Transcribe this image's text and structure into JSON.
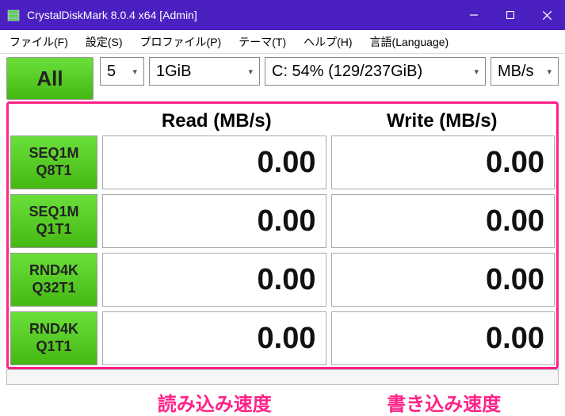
{
  "window": {
    "title": "CrystalDiskMark 8.0.4 x64 [Admin]"
  },
  "menu": {
    "file": "ファイル(F)",
    "settings": "設定(S)",
    "profile": "プロファイル(P)",
    "theme": "テーマ(T)",
    "help": "ヘルプ(H)",
    "language": "言語(Language)"
  },
  "toolbar": {
    "all_label": "All",
    "count": "5",
    "size": "1GiB",
    "drive": "C: 54% (129/237GiB)",
    "unit": "MB/s"
  },
  "headers": {
    "read": "Read (MB/s)",
    "write": "Write (MB/s)"
  },
  "tests": [
    {
      "line1": "SEQ1M",
      "line2": "Q8T1",
      "read": "0.00",
      "write": "0.00"
    },
    {
      "line1": "SEQ1M",
      "line2": "Q1T1",
      "read": "0.00",
      "write": "0.00"
    },
    {
      "line1": "RND4K",
      "line2": "Q32T1",
      "read": "0.00",
      "write": "0.00"
    },
    {
      "line1": "RND4K",
      "line2": "Q1T1",
      "read": "0.00",
      "write": "0.00"
    }
  ],
  "footer": {
    "read_label": "読み込み速度",
    "write_label": "書き込み速度"
  }
}
